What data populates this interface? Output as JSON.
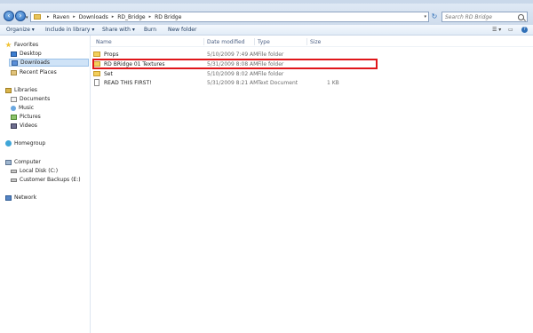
{
  "window": {
    "title": "Raven"
  },
  "address": {
    "segments": [
      "Raven",
      "Downloads",
      "RD_Bridge",
      "RD Bridge"
    ],
    "search_placeholder": "Search RD Bridge"
  },
  "toolbar": {
    "organize": "Organize ▾",
    "include": "Include in library ▾",
    "share": "Share with ▾",
    "burn": "Burn",
    "newfolder": "New folder"
  },
  "nav": {
    "favorites": "Favorites",
    "desktop": "Desktop",
    "downloads": "Downloads",
    "recent": "Recent Places",
    "libraries": "Libraries",
    "documents": "Documents",
    "music": "Music",
    "pictures": "Pictures",
    "videos": "Videos",
    "homegroup": "Homegroup",
    "computer": "Computer",
    "localdisk": "Local Disk (C:)",
    "backups": "Customer Backups (E:)",
    "network": "Network"
  },
  "columns": {
    "name": "Name",
    "date": "Date modified",
    "type": "Type",
    "size": "Size"
  },
  "files": [
    {
      "name": "Props",
      "date": "5/10/2009 7:49 AM",
      "type": "File folder",
      "size": ""
    },
    {
      "name": "RD BRidge 01 Textures",
      "date": "5/31/2009 8:08 AM",
      "type": "File folder",
      "size": ""
    },
    {
      "name": "Set",
      "date": "5/10/2009 8:02 AM",
      "type": "File folder",
      "size": ""
    },
    {
      "name": "READ THIS FIRST!",
      "date": "5/31/2009 8:21 AM",
      "type": "Text Document",
      "size": "1 KB"
    }
  ],
  "colors": {
    "highlight": "#e0161a",
    "selection": "#cfe3f7"
  }
}
